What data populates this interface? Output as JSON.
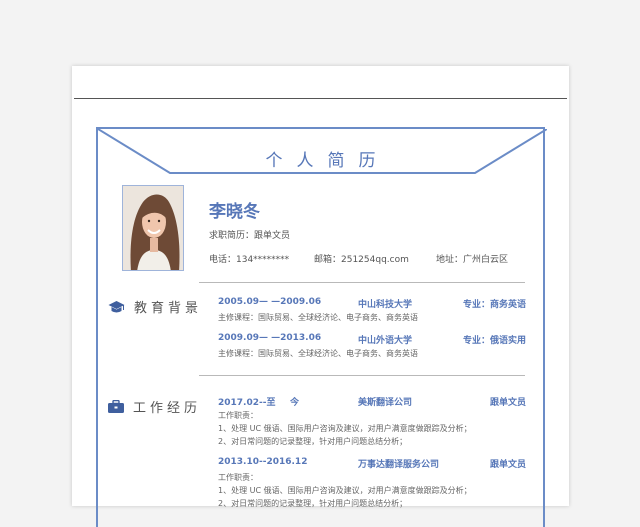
{
  "resume": {
    "title": "个人简历",
    "name": "李晓冬",
    "job_label": "求职简历：跟单文员",
    "phone": "电话：134********",
    "email": "邮箱：251254qq.com",
    "address": "地址：广州白云区"
  },
  "education": {
    "heading": "教育背景",
    "entries": [
      {
        "period": "2005.09— —2009.06",
        "school": "中山科技大学",
        "major": "专业：商务英语",
        "courses": "主修课程：国际贸易、全球经济论、电子商务、商务英语"
      },
      {
        "period": "2009.09— —2013.06",
        "school": "中山外语大学",
        "major": "专业：俄语实用",
        "courses": "主修课程：国际贸易、全球经济论、电子商务、商务英语"
      }
    ]
  },
  "work": {
    "heading": "工作经历",
    "entries": [
      {
        "period_start": "2017.02--至",
        "period_end": "今",
        "company": "美斯翻译公司",
        "position": "跟单文员",
        "duties_label": "工作职责：",
        "duties": [
          "1、处理 UC 俄语、国际用户咨询及建议，对用户满意度做跟踪及分析；",
          "2、对日常问题的记录整理，针对用户问题总结分析；"
        ]
      },
      {
        "period": "2013.10--2016.12",
        "company": "万事达翻译服务公司",
        "position": "跟单文员",
        "duties_label": "工作职责：",
        "duties": [
          "1、处理 UC 俄语、国际用户咨询及建议，对用户满意度做跟踪及分析；",
          "2、对日常问题的记录整理，针对用户问题总结分析；"
        ]
      }
    ]
  },
  "colors": {
    "accent": "#5777b8",
    "frame": "#6b8cc7",
    "text": "#555555"
  }
}
